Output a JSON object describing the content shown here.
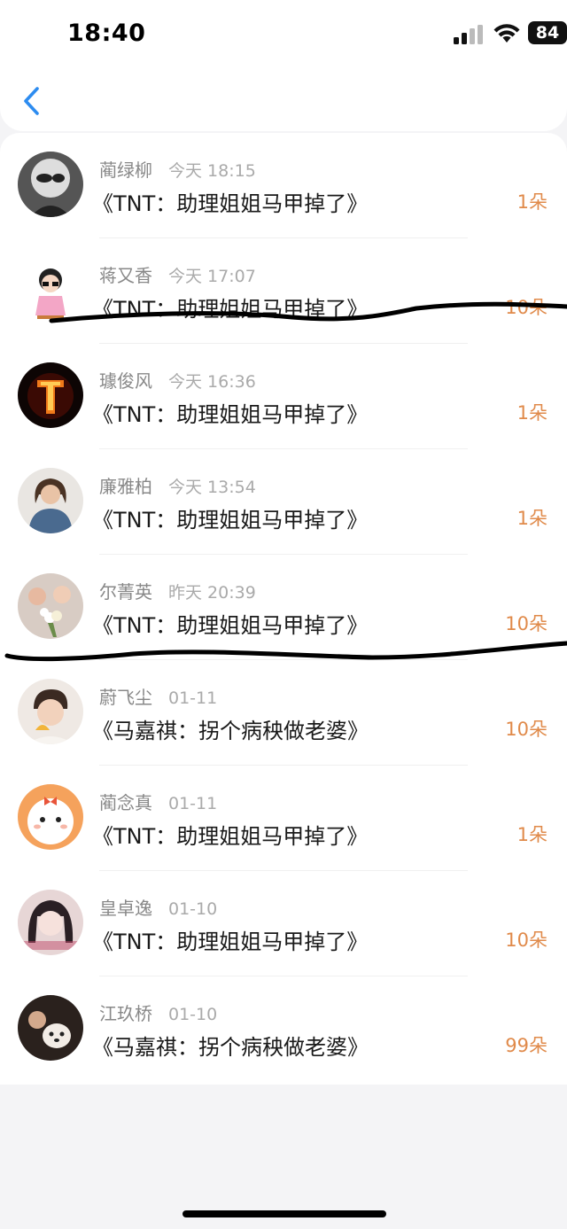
{
  "status": {
    "time": "18:40",
    "battery": "84"
  },
  "rows": [
    {
      "name": "蔺绿柳",
      "time": "今天 18:15",
      "title": "《TNT：助理姐姐马甲掉了》",
      "amount": "1朵"
    },
    {
      "name": "蒋又香",
      "time": "今天 17:07",
      "title": "《TNT：助理姐姐马甲掉了》",
      "amount": "10朵"
    },
    {
      "name": "璩俊风",
      "time": "今天 16:36",
      "title": "《TNT：助理姐姐马甲掉了》",
      "amount": "1朵"
    },
    {
      "name": "廉雅柏",
      "time": "今天 13:54",
      "title": "《TNT：助理姐姐马甲掉了》",
      "amount": "1朵"
    },
    {
      "name": "尔菁英",
      "time": "昨天 20:39",
      "title": "《TNT：助理姐姐马甲掉了》",
      "amount": "10朵"
    },
    {
      "name": "蔚飞尘",
      "time": "01-11",
      "title": "《马嘉祺：拐个病秧做老婆》",
      "amount": "10朵"
    },
    {
      "name": "蔺念真",
      "time": "01-11",
      "title": "《TNT：助理姐姐马甲掉了》",
      "amount": "1朵"
    },
    {
      "name": "皇卓逸",
      "time": "01-10",
      "title": "《TNT：助理姐姐马甲掉了》",
      "amount": "10朵"
    },
    {
      "name": "江玖桥",
      "time": "01-10",
      "title": "《马嘉祺：拐个病秧做老婆》",
      "amount": "99朵"
    }
  ],
  "colors": {
    "accent": "#e08a4a",
    "back": "#2d8cf0"
  },
  "icons": {
    "back": "chevron-left-icon",
    "signal": "cellular-signal-icon",
    "wifi": "wifi-icon",
    "battery": "battery-icon"
  }
}
